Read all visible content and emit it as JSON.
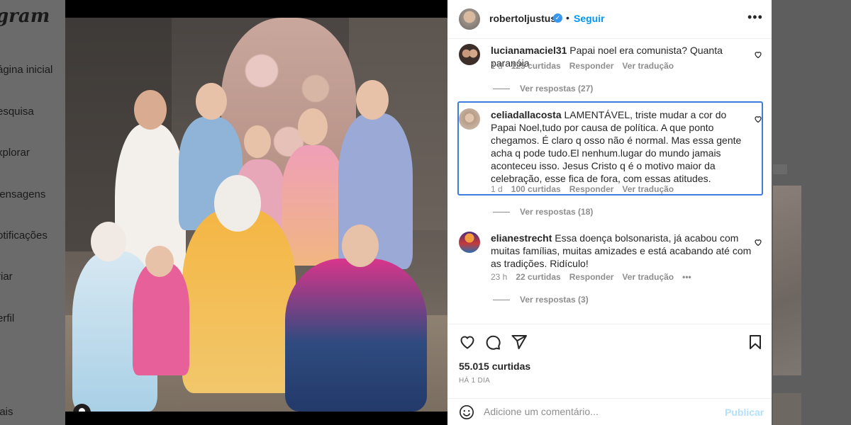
{
  "sidebar": {
    "logo": "gram",
    "items": [
      {
        "label": "ágina inicial",
        "icon": "home-icon"
      },
      {
        "label": "esquisa",
        "icon": "search-icon"
      },
      {
        "label": "xplorar",
        "icon": "explore-icon"
      },
      {
        "label": "lensagens",
        "icon": "messages-icon"
      },
      {
        "label": "otificações",
        "icon": "notifications-icon"
      },
      {
        "label": "riar",
        "icon": "create-icon"
      },
      {
        "label": "erfil",
        "icon": "profile-icon"
      },
      {
        "label": "lais",
        "icon": "more-icon"
      }
    ]
  },
  "post": {
    "username": "robertoljustus",
    "verified": true,
    "separator": "•",
    "follow_label": "Seguir",
    "more_icon": "more-horizontal-icon",
    "likes": "55.015 curtidas",
    "posted_ago": "HÁ 1 DIA"
  },
  "comments": [
    {
      "username": "lucianamaciel31",
      "text": "Papai noel era comunista? Quanta paranóia",
      "age": "1 d",
      "likes": "125 curtidas",
      "reply_label": "Responder",
      "translate_label": "Ver tradução",
      "replies_label": "Ver respostas (27)"
    },
    {
      "username": "celiadallacosta",
      "text": "LAMENTÁVEL, triste mudar a cor do Papai Noel,tudo por causa de política. A que ponto chegamos. É claro q osso não é normal. Mas essa gente acha q pode tudo.El nenhum.lugar do mundo jamais aconteceu isso. Jesus Cristo q é o motivo maior da celebração, esse fica de fora, com essas atitudes.",
      "age": "1 d",
      "likes": "100 curtidas",
      "reply_label": "Responder",
      "translate_label": "Ver tradução",
      "replies_label": "Ver respostas (18)"
    },
    {
      "username": "elianestrecht",
      "text": "Essa doença bolsonarista, já acabou com muitas famílias, muitas amizades e está acabando até com as tradições. Ridículo!",
      "age": "23 h",
      "likes": "22 curtidas",
      "reply_label": "Responder",
      "translate_label": "Ver tradução",
      "options_label": "•••",
      "replies_label": "Ver respostas (3)"
    }
  ],
  "add_comment": {
    "placeholder": "Adicione um comentário...",
    "publish_label": "Publicar"
  },
  "colors": {
    "accent": "#0095f6",
    "highlight_border": "#3d7be0",
    "muted": "#8e8e8e"
  }
}
